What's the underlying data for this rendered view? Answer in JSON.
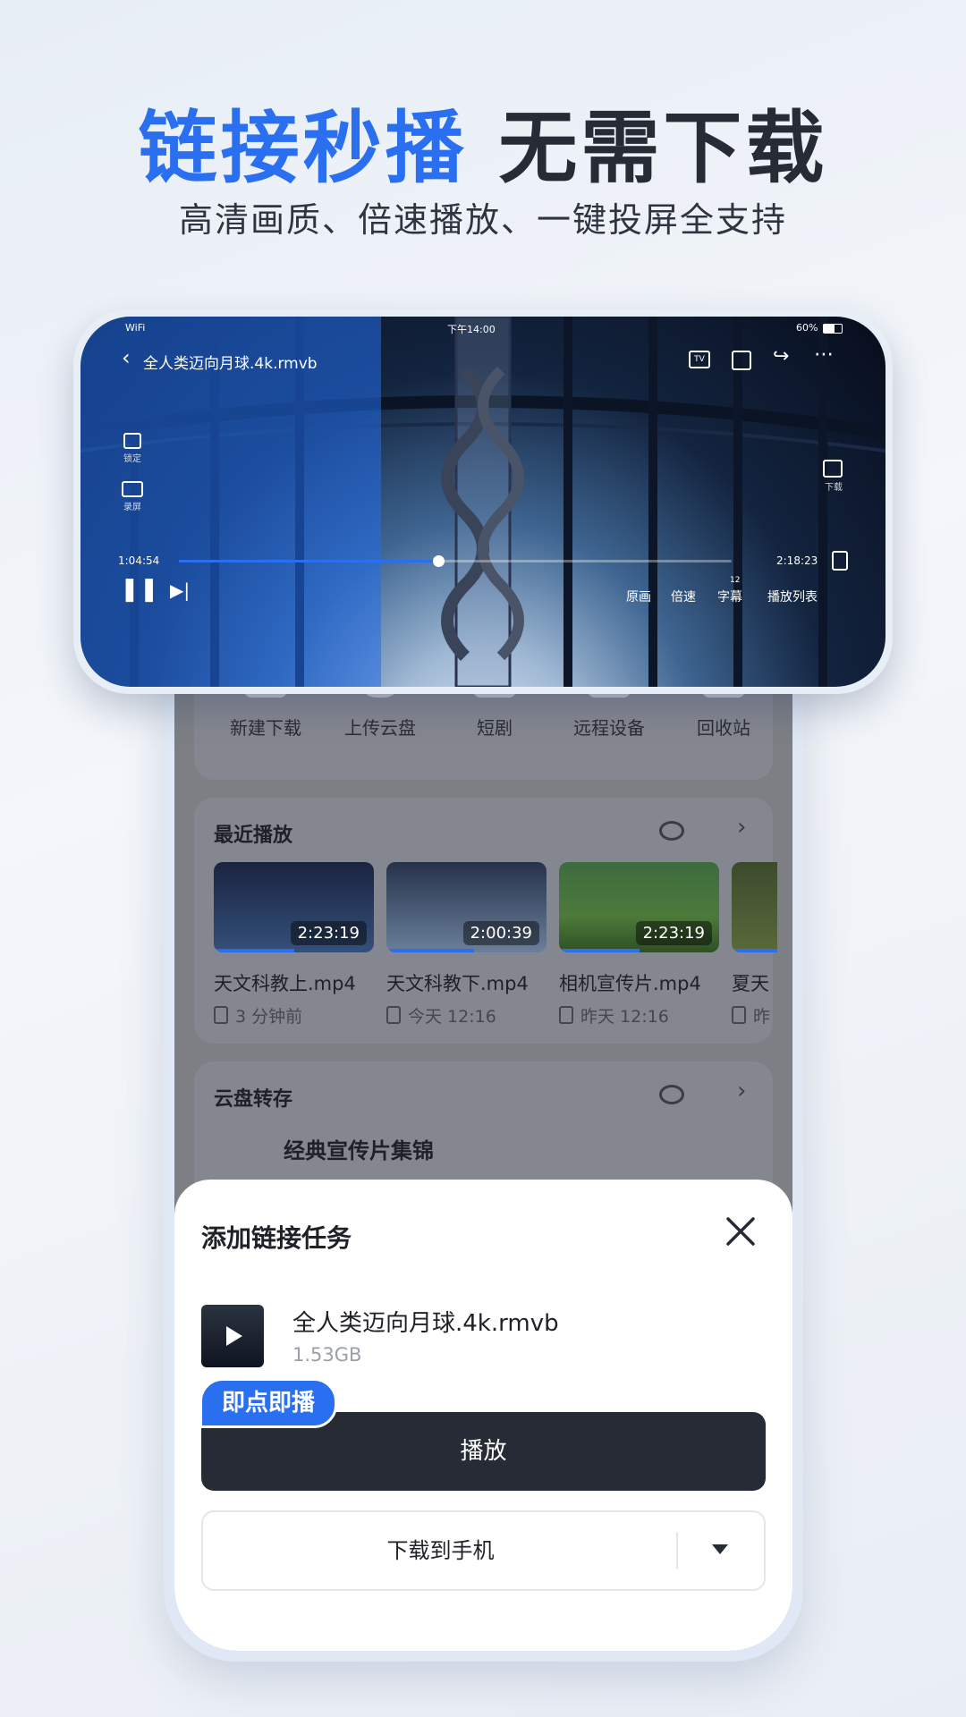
{
  "headline": {
    "blue": "链接秒播",
    "dark": "无需下载"
  },
  "subheadline": "高清画质、倍速播放、一键投屏全支持",
  "player": {
    "status": {
      "network": "WiFi",
      "time": "下午14:00",
      "battery": "60%"
    },
    "title": "全人类迈向月球.4k.rmvb",
    "left_controls": {
      "lock": "锁定",
      "record": "录屏"
    },
    "right_controls": {
      "download": "下载"
    },
    "time_current": "1:04:54",
    "time_total": "2:18:23",
    "progress": 0.47,
    "bottom_buttons": {
      "quality": "原画",
      "speed": "倍速",
      "subtitle": "字幕",
      "subtitle_count": "12",
      "playlist": "播放列表"
    }
  },
  "tools": [
    {
      "label": "新建下载",
      "icon": "download-icon"
    },
    {
      "label": "上传云盘",
      "icon": "cloud-upload-icon"
    },
    {
      "label": "短剧",
      "icon": "play-icon"
    },
    {
      "label": "远程设备",
      "icon": "router-icon"
    },
    {
      "label": "回收站",
      "icon": "trash-icon"
    }
  ],
  "recent": {
    "title": "最近播放",
    "items": [
      {
        "name": "天文科教上.mp4",
        "duration": "2:23:19",
        "time": "3 分钟前",
        "progress": 0.5
      },
      {
        "name": "天文科教下.mp4",
        "duration": "2:00:39",
        "time": "今天 12:16",
        "progress": 0.55
      },
      {
        "name": "相机宣传片.mp4",
        "duration": "2:23:19",
        "time": "昨天 12:16",
        "progress": 0.5
      },
      {
        "name": "夏天",
        "duration": "",
        "time": "昨",
        "progress": 1.0
      }
    ]
  },
  "cloud": {
    "title": "云盘转存",
    "first_item": "经典宣传片集锦"
  },
  "sheet": {
    "title": "添加链接任务",
    "file_name": "全人类迈向月球.4k.rmvb",
    "file_size": "1.53GB",
    "badge": "即点即播",
    "play_label": "播放",
    "download_label": "下载到手机"
  },
  "colors": {
    "accent": "#2a6ff0",
    "dark_button": "#262b36"
  }
}
